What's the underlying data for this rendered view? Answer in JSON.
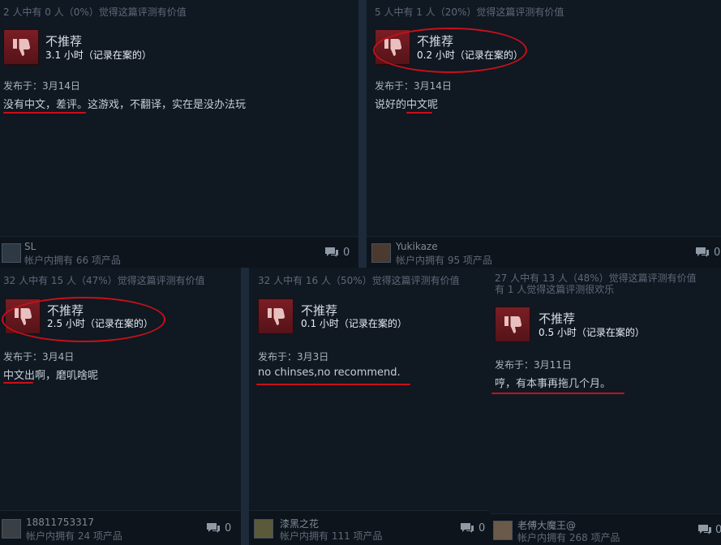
{
  "reviews": [
    {
      "helpful": "2 人中有 0 人（0%）觉得这篇评测有价值",
      "helpful2": "",
      "verdict": "不推荐",
      "hours": "3.1 小时（记录在案的）",
      "posted": "发布于：3月14日",
      "text": "没有中文，差评。这游戏，不翻译，实在是没办法玩",
      "user": "SL",
      "owned": "帐户内拥有 66 项产品",
      "comments": "0"
    },
    {
      "helpful": "5 人中有 1 人（20%）觉得这篇评测有价值",
      "helpful2": "",
      "verdict": "不推荐",
      "hours": "0.2 小时（记录在案的）",
      "posted": "发布于：3月14日",
      "text": "说好的中文呢",
      "user": "Yukikaze",
      "owned": "帐户内拥有 95 项产品",
      "comments": "0"
    },
    {
      "helpful": "32 人中有 15 人（47%）觉得这篇评测有价值",
      "helpful2": "",
      "verdict": "不推荐",
      "hours": "2.5 小时（记录在案的）",
      "posted": "发布于：3月4日",
      "text": "中文出啊，磨叽啥呢",
      "user": "18811753317",
      "owned": "帐户内拥有 24 项产品",
      "comments": "0"
    },
    {
      "helpful": "32 人中有 16 人（50%）觉得这篇评测有价值",
      "helpful2": "",
      "verdict": "不推荐",
      "hours": "0.1 小时（记录在案的）",
      "posted": "发布于：3月3日",
      "text": "no chinses,no recommend.",
      "user": "漆黑之花",
      "owned": "帐户内拥有 111 项产品",
      "comments": "0"
    },
    {
      "helpful": "27 人中有 13 人（48%）觉得这篇评测有价值",
      "helpful2": "有 1 人觉得这篇评测很欢乐",
      "verdict": "不推荐",
      "hours": "0.5 小时（记录在案的）",
      "posted": "发布于：3月11日",
      "text": "哼，有本事再拖几个月。",
      "user": "老傅大魔王@",
      "owned": "帐户内拥有 268 项产品",
      "comments": "0"
    }
  ],
  "colors": {
    "accent_red": "#c8101a",
    "thumb_bg": "#7a1e24"
  },
  "icons": {
    "thumb": "thumbs-down-icon",
    "comment": "comment-icon"
  }
}
